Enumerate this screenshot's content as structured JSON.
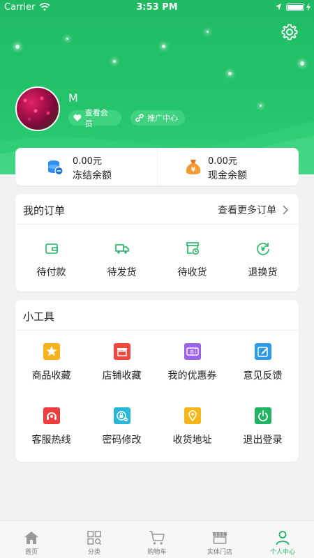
{
  "status_bar": {
    "carrier": "Carrier",
    "time": "3:53 PM"
  },
  "colors": {
    "brand_green": "#1fbb63",
    "active_tab": "#1fb562"
  },
  "profile": {
    "username": "M",
    "vip_button": "查看会员",
    "promo_button": "推广中心"
  },
  "balance": {
    "frozen": {
      "amount": "0.00元",
      "label": "冻结余额",
      "icon": "coins-stack-icon"
    },
    "cash": {
      "amount": "0.00元",
      "label": "现金余额",
      "icon": "money-bag-icon"
    }
  },
  "orders": {
    "title": "我的订单",
    "more": "查看更多订单",
    "items": [
      {
        "label": "待付款",
        "icon": "wallet-icon"
      },
      {
        "label": "待发货",
        "icon": "truck-icon"
      },
      {
        "label": "待收货",
        "icon": "package-clock-icon"
      },
      {
        "label": "退换货",
        "icon": "refund-icon"
      }
    ]
  },
  "tools": {
    "title": "小工具",
    "items": [
      {
        "label": "商品收藏",
        "icon": "star-icon"
      },
      {
        "label": "店铺收藏",
        "icon": "store-icon"
      },
      {
        "label": "我的优惠券",
        "icon": "coupon-icon"
      },
      {
        "label": "意见反馈",
        "icon": "edit-icon"
      },
      {
        "label": "客服热线",
        "icon": "headset-icon"
      },
      {
        "label": "密码修改",
        "icon": "lock-icon"
      },
      {
        "label": "收货地址",
        "icon": "location-icon"
      },
      {
        "label": "退出登录",
        "icon": "power-icon"
      }
    ]
  },
  "tabbar": {
    "items": [
      {
        "label": "首页",
        "icon": "home-icon"
      },
      {
        "label": "分类",
        "icon": "category-icon"
      },
      {
        "label": "购物车",
        "icon": "cart-icon"
      },
      {
        "label": "实体门店",
        "icon": "storefront-icon"
      },
      {
        "label": "个人中心",
        "icon": "user-icon",
        "active": true
      }
    ]
  }
}
